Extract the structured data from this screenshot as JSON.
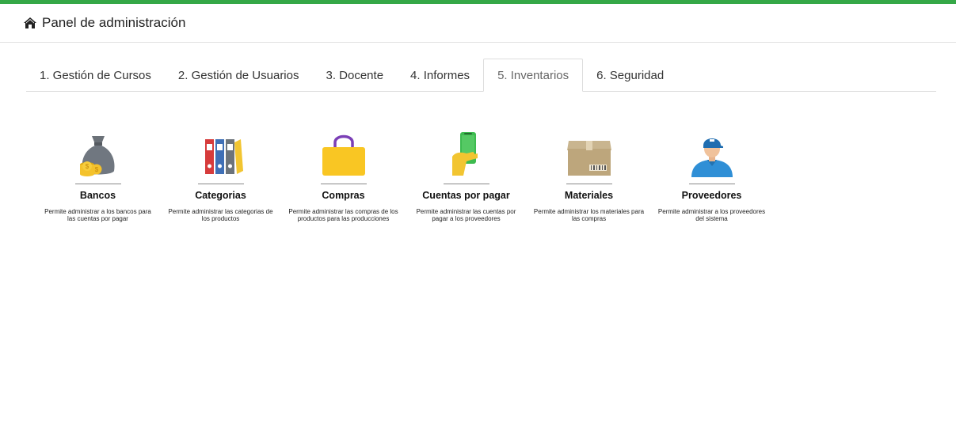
{
  "header": {
    "title": "Panel de administración",
    "icon": "home-icon"
  },
  "tabs": [
    {
      "label": "1. Gestión de Cursos",
      "active": false
    },
    {
      "label": "2. Gestión de Usuarios",
      "active": false
    },
    {
      "label": "3. Docente",
      "active": false
    },
    {
      "label": "4. Informes",
      "active": false
    },
    {
      "label": "5. Inventarios",
      "active": true
    },
    {
      "label": "6. Seguridad",
      "active": false
    }
  ],
  "modules": [
    {
      "title": "Bancos",
      "description": "Permite administrar a los bancos para las cuentas por pagar",
      "icon": "money-bag-icon"
    },
    {
      "title": "Categorias",
      "description": "Permite administrar las categorias de los productos",
      "icon": "binders-icon"
    },
    {
      "title": "Compras",
      "description": "Permite administrar las compras de los productos para las producciones",
      "icon": "shopping-bag-icon"
    },
    {
      "title": "Cuentas por pagar",
      "description": "Permite administrar las cuentas por pagar a los proveedores",
      "icon": "phone-payment-icon"
    },
    {
      "title": "Materiales",
      "description": "Permite administrar los materiales para las compras",
      "icon": "box-icon"
    },
    {
      "title": "Proveedores",
      "description": "Permite administrar a los proveedores del sistema",
      "icon": "supplier-icon"
    }
  ],
  "colors": {
    "accent": "#35a847",
    "compras_yellow": "#f9c623",
    "cuentas_green": "#3dbb4f"
  }
}
